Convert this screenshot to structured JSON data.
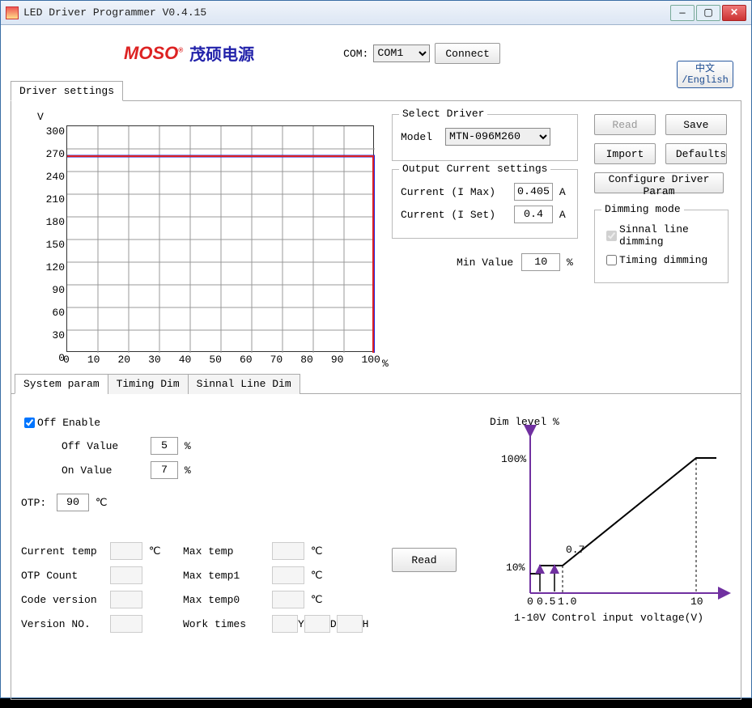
{
  "window": {
    "title": "LED Driver Programmer V0.4.15"
  },
  "logo": {
    "brand": "MOSO",
    "reg": "®",
    "chinese": "茂硕电源"
  },
  "com": {
    "label": "COM:",
    "selected": "COM1"
  },
  "buttons": {
    "connect": "Connect",
    "lang_top": "中文",
    "lang_bottom": "/English",
    "read": "Read",
    "save": "Save",
    "import": "Import",
    "defaults": "Defaults",
    "configure": "Configure Driver Param",
    "sp_read": "Read"
  },
  "main_tab": "Driver settings",
  "chart": {
    "ylabel": "V",
    "xlabel": "%",
    "xticks": [
      "0",
      "10",
      "20",
      "30",
      "40",
      "50",
      "60",
      "70",
      "80",
      "90",
      "100"
    ],
    "yticks": [
      "0",
      "30",
      "60",
      "90",
      "120",
      "150",
      "180",
      "210",
      "240",
      "270",
      "300"
    ]
  },
  "chart_data": {
    "type": "line",
    "title": "",
    "xlabel": "%",
    "ylabel": "V",
    "xlim": [
      0,
      100
    ],
    "ylim": [
      0,
      300
    ],
    "series": [
      {
        "name": "red",
        "color": "#d22",
        "x": [
          0,
          100,
          100
        ],
        "y": [
          260,
          260,
          0
        ]
      },
      {
        "name": "blue",
        "color": "#22d",
        "x": [
          0,
          100,
          100
        ],
        "y": [
          260,
          260,
          0
        ]
      }
    ]
  },
  "driver": {
    "group_title": "Select Driver",
    "model_label": "Model",
    "model_value": "MTN-096M260"
  },
  "output": {
    "group_title": "Output Current settings",
    "imax_label": "Current  (I Max)",
    "imax_value": "0.405",
    "imax_unit": "A",
    "iset_label": "Current  (I Set)",
    "iset_value": "0.4",
    "iset_unit": "A",
    "min_label": "Min Value",
    "min_value": "10",
    "min_unit": "%"
  },
  "dimming": {
    "group_title": "Dimming mode",
    "signal_label": "Sinnal line dimming",
    "signal_checked": true,
    "timing_label": "Timing dimming",
    "timing_checked": false
  },
  "subtabs": {
    "items": [
      "System param",
      "Timing Dim",
      "Sinnal Line Dim"
    ],
    "active": 0
  },
  "system_param": {
    "off_enable": "Off Enable",
    "off_enable_checked": true,
    "off_value_label": "Off Value",
    "off_value": "5",
    "off_unit": "%",
    "on_value_label": "On Value",
    "on_value": "7",
    "on_unit": "%",
    "otp_label": "OTP:",
    "otp_value": "90",
    "otp_unit": "℃",
    "fields": [
      {
        "label": "Current temp",
        "unit": "℃"
      },
      {
        "label": "OTP Count",
        "unit": ""
      },
      {
        "label": "Code version",
        "unit": ""
      },
      {
        "label": "Version NO.",
        "unit": ""
      }
    ],
    "fields2": [
      {
        "label": "Max temp",
        "unit": "℃"
      },
      {
        "label": "Max temp1",
        "unit": "℃"
      },
      {
        "label": "Max temp0",
        "unit": "℃"
      },
      {
        "label": "Work times",
        "unit": "Y"
      }
    ],
    "work_extra": [
      "D",
      "H"
    ]
  },
  "dim_chart": {
    "ylabel": "Dim level %",
    "xlabel": "1-10V Control input voltage(V)",
    "y_marks": [
      "100%",
      "10%"
    ],
    "x_marks": [
      "0",
      "0.5",
      "1.0",
      "10"
    ],
    "annotation": "0.7"
  }
}
